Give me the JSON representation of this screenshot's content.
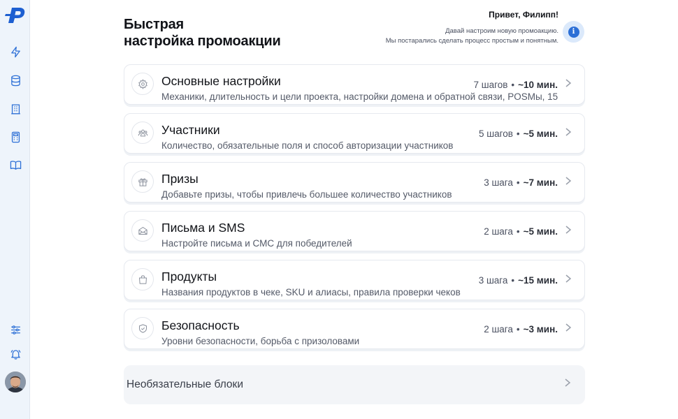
{
  "sidebar": {
    "items": [
      {
        "name": "lightning-icon"
      },
      {
        "name": "database-icon"
      },
      {
        "name": "building-icon"
      },
      {
        "name": "calculator-icon"
      },
      {
        "name": "book-icon"
      }
    ],
    "bottom": [
      {
        "name": "sliders-icon"
      },
      {
        "name": "bell-icon"
      }
    ]
  },
  "header": {
    "title_line1": "Быстрая",
    "title_line2": "настройка промоакции",
    "greeting": "Привет, Филипп!",
    "sub_line1": "Давай настроим новую промоакцию.",
    "sub_line2": "Мы постарались сделать процесс простым и понятным."
  },
  "colors": {
    "accent": "#2c6fd6",
    "sidebar_bg": "#eef4fb"
  },
  "sections": [
    {
      "icon": "gear-icon",
      "title": "Основные настройки",
      "desc": "Механики, длительность и цели проекта, настройки домена и обратной связи, POSMы, 15",
      "steps": "7 шагов",
      "dot": "•",
      "duration": "~10 мин."
    },
    {
      "icon": "users-icon",
      "title": "Участники",
      "desc": "Количество, обязательные поля и способ авторизации участников",
      "steps": "5 шагов",
      "dot": "•",
      "duration": "~5 мин."
    },
    {
      "icon": "gift-icon",
      "title": "Призы",
      "desc": "Добавьте призы, чтобы привлечь большее количество участников",
      "steps": "3 шага",
      "dot": "•",
      "duration": "~7 мин."
    },
    {
      "icon": "mail-icon",
      "title": "Письма и SMS",
      "desc": "Настройте письма и СМС для победителей",
      "steps": "2 шага",
      "dot": "•",
      "duration": "~5 мин."
    },
    {
      "icon": "bag-icon",
      "title": "Продукты",
      "desc": "Названия продуктов в чеке, SKU и алиасы, правила проверки чеков",
      "steps": "3 шага",
      "dot": "•",
      "duration": "~15 мин."
    },
    {
      "icon": "shield-icon",
      "title": "Безопасность",
      "desc": "Уровни безопасности, борьба с призоловами",
      "steps": "2 шага",
      "dot": "•",
      "duration": "~3 мин."
    }
  ],
  "optional": {
    "label": "Необязательные блоки"
  }
}
